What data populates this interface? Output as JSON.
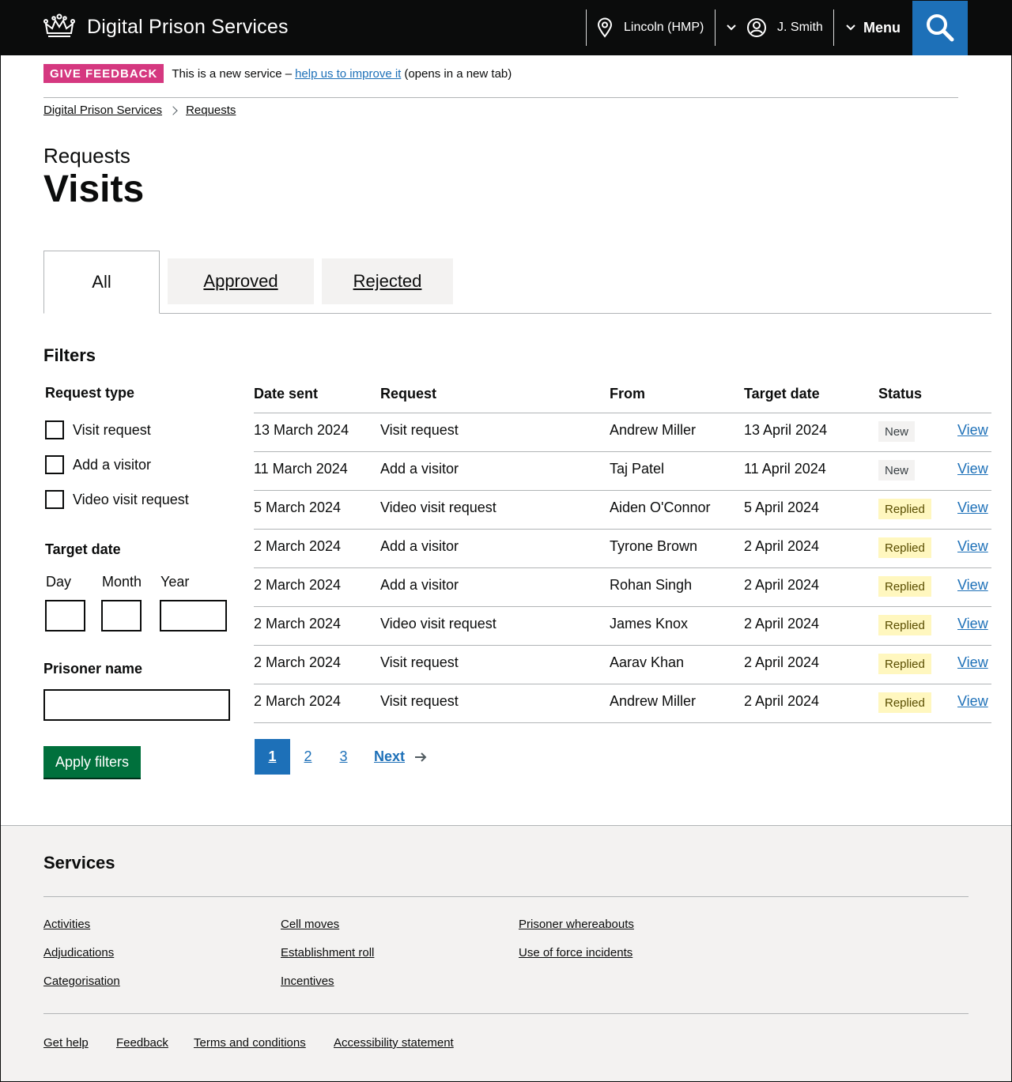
{
  "header": {
    "service_name": "Digital Prison Services",
    "location": "Lincoln (HMP)",
    "user": "J. Smith",
    "menu_label": "Menu"
  },
  "phase_banner": {
    "tag": "GIVE FEEDBACK",
    "text_before": "This is a new service –",
    "link": "help us to improve it",
    "text_after": "(opens in a new tab)"
  },
  "breadcrumbs": [
    "Digital Prison Services",
    "Requests"
  ],
  "page": {
    "caption": "Requests",
    "title": "Visits"
  },
  "tabs": [
    {
      "label": "All",
      "active": true
    },
    {
      "label": "Approved",
      "active": false
    },
    {
      "label": "Rejected",
      "active": false
    }
  ],
  "filters": {
    "heading": "Filters",
    "request_type_label": "Request type",
    "request_types": [
      "Visit request",
      "Add a visitor",
      "Video visit request"
    ],
    "target_date_label": "Target date",
    "day_label": "Day",
    "month_label": "Month",
    "year_label": "Year",
    "prisoner_name_label": "Prisoner name",
    "apply_label": "Apply filters"
  },
  "table": {
    "headers": [
      "Date sent",
      "Request",
      "From",
      "Target date",
      "Status"
    ],
    "rows": [
      {
        "date_sent": "13 March 2024",
        "request": "Visit request",
        "from": "Andrew Miller",
        "target": "13 April 2024",
        "status": "New",
        "link": "View"
      },
      {
        "date_sent": "11 March 2024",
        "request": "Add a visitor",
        "from": "Taj Patel",
        "target": "11 April 2024",
        "status": "New",
        "link": "View"
      },
      {
        "date_sent": "5 March 2024",
        "request": "Video visit request",
        "from": "Aiden O'Connor",
        "target": "5 April 2024",
        "status": "Replied",
        "link": "View"
      },
      {
        "date_sent": "2 March 2024",
        "request": "Add a visitor",
        "from": "Tyrone Brown",
        "target": "2 April 2024",
        "status": "Replied",
        "link": "View"
      },
      {
        "date_sent": "2 March 2024",
        "request": "Add a visitor",
        "from": "Rohan Singh",
        "target": "2 April 2024",
        "status": "Replied",
        "link": "View"
      },
      {
        "date_sent": "2 March 2024",
        "request": "Video visit request",
        "from": "James Knox",
        "target": "2 April 2024",
        "status": "Replied",
        "link": "View"
      },
      {
        "date_sent": "2 March 2024",
        "request": "Visit request",
        "from": "Aarav Khan",
        "target": "2 April 2024",
        "status": "Replied",
        "link": "View"
      },
      {
        "date_sent": "2 March 2024",
        "request": "Visit request",
        "from": "Andrew Miller",
        "target": "2 April 2024",
        "status": "Replied",
        "link": "View"
      }
    ]
  },
  "pagination": {
    "pages": [
      "1",
      "2",
      "3"
    ],
    "current": "1",
    "next_label": "Next"
  },
  "footer": {
    "heading": "Services",
    "services": [
      [
        "Activities",
        "Adjudications",
        "Categorisation"
      ],
      [
        "Cell moves",
        "Establishment roll",
        "Incentives"
      ],
      [
        "Prisoner whereabouts",
        "Use of force incidents"
      ]
    ],
    "meta_links": [
      "Get help",
      "Feedback",
      "Terms and conditions",
      "Accessibility statement"
    ]
  },
  "colors": {
    "header_bg": "#0b0c0c",
    "accent_blue": "#1d70b8",
    "feedback_pink": "#d53880",
    "button_green": "#00703c",
    "replied_bg": "#fff7bf",
    "new_bg": "#f3f2f1"
  }
}
